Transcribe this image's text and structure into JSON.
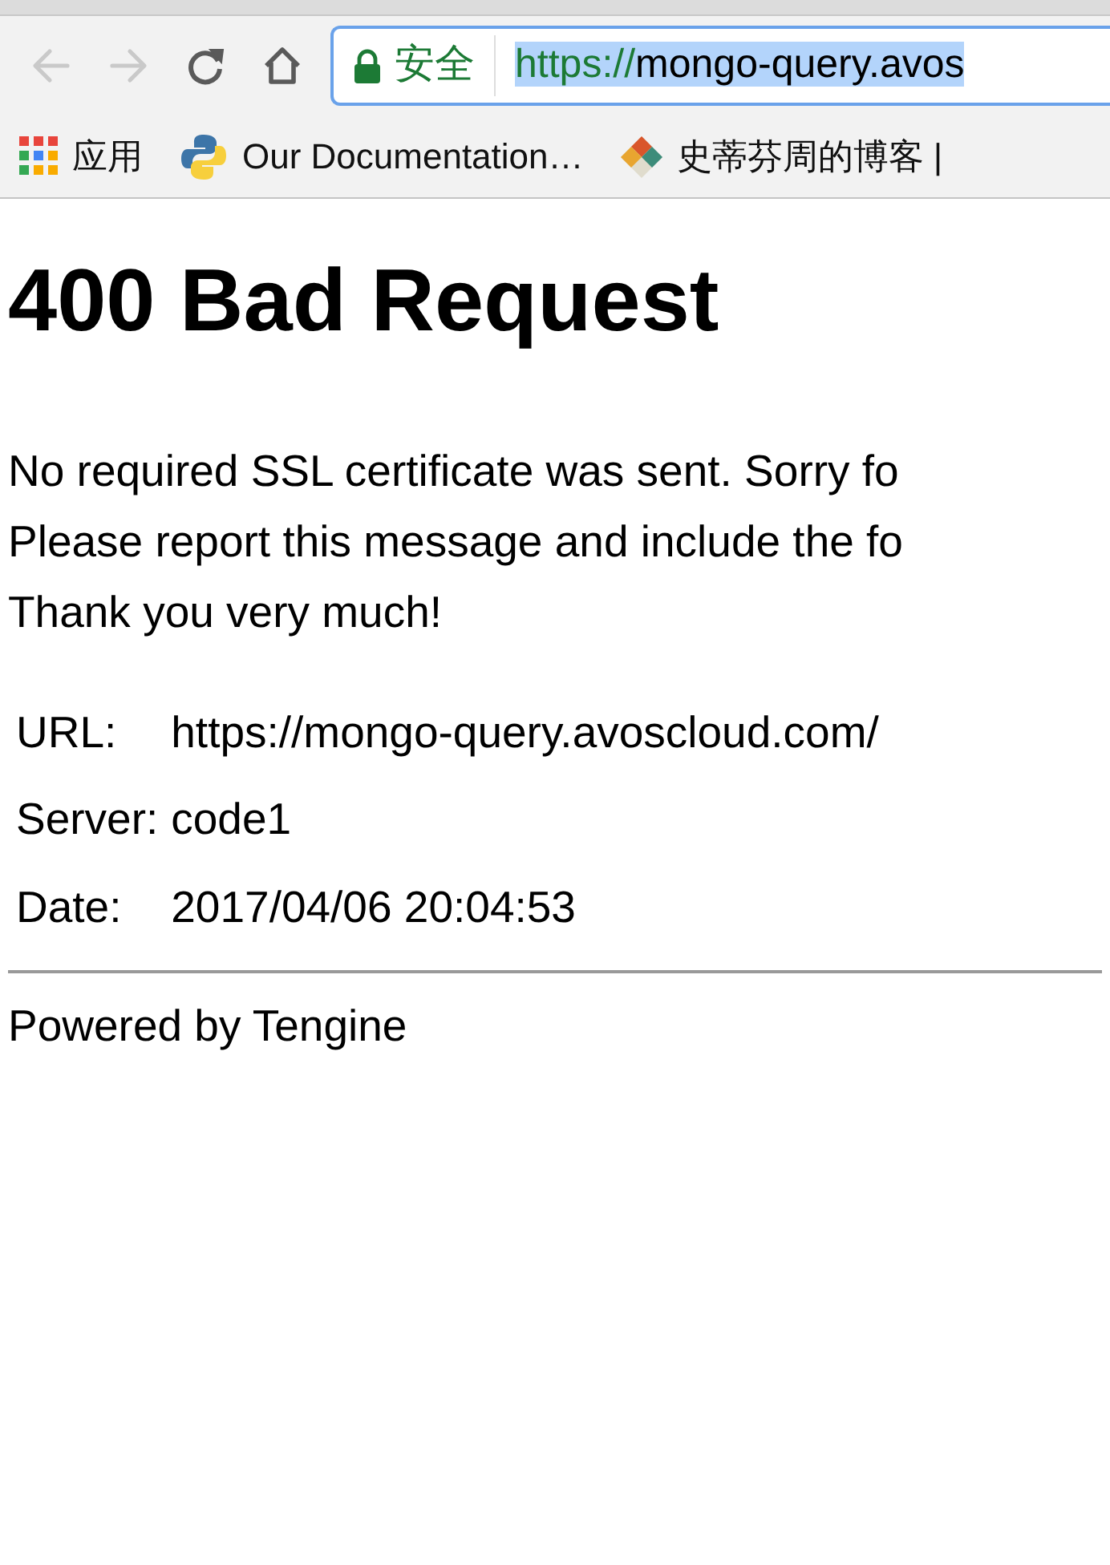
{
  "toolbar": {
    "nav_buttons": [
      {
        "kind": "back",
        "disabled": true
      },
      {
        "kind": "forward",
        "disabled": true
      },
      {
        "kind": "reload",
        "disabled": false
      },
      {
        "kind": "home",
        "disabled": false
      }
    ],
    "address_bar": {
      "security_label": "安全",
      "scheme": "https://",
      "rest": "mongo-query.avos",
      "selected": true
    }
  },
  "bookmarks": [
    {
      "kind": "apps",
      "label": "应用"
    },
    {
      "kind": "python",
      "label": "Our Documentation…"
    },
    {
      "kind": "blog",
      "label": "史蒂芬周的博客 |"
    }
  ],
  "page": {
    "heading": "400 Bad Request",
    "message_lines": [
      "No required SSL certificate was sent. Sorry fo",
      "Please report this message and include the fo",
      "Thank you very much!"
    ],
    "details": [
      {
        "label": "URL:",
        "value": "https://mongo-query.avoscloud.com/"
      },
      {
        "label": "Server:",
        "value": "code1"
      },
      {
        "label": "Date:",
        "value": "2017/04/06 20:04:53"
      }
    ],
    "footer": "Powered by Tengine"
  }
}
